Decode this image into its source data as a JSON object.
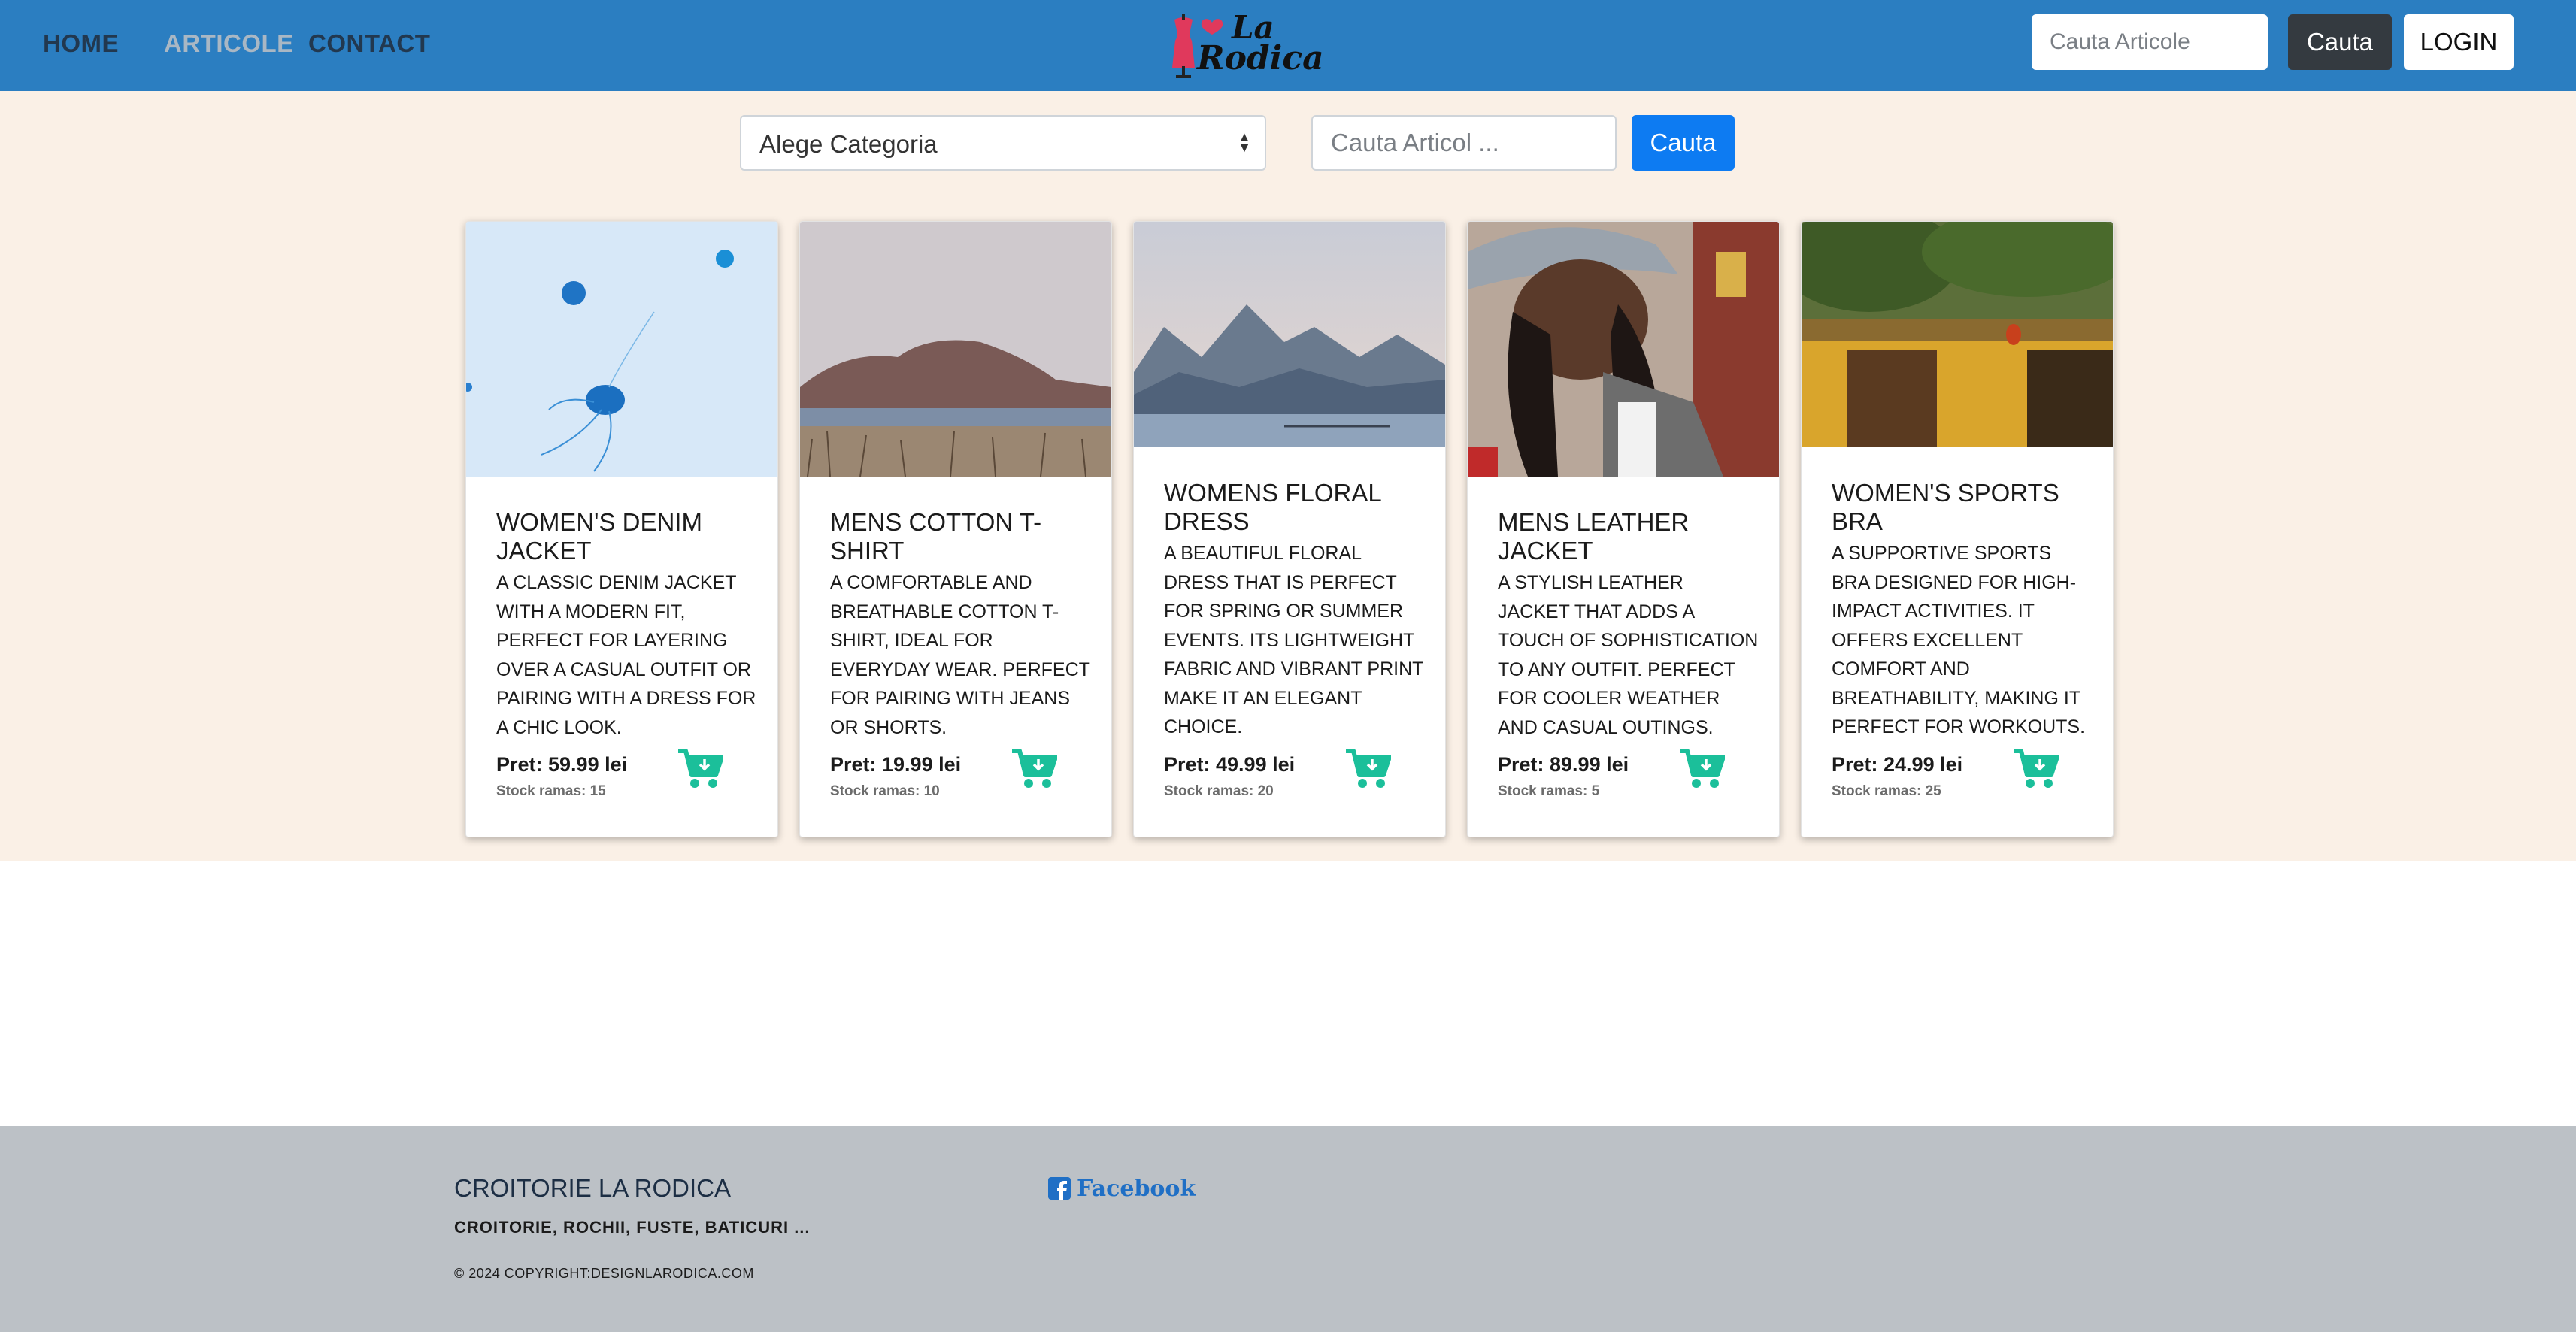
{
  "nav": {
    "home": "HOME",
    "articole": "ARTICOLE",
    "contact": "CONTACT",
    "logo_line1": "La",
    "logo_line2": "Rodica",
    "search_placeholder": "Cauta Articole",
    "search_button": "Cauta",
    "login_button": "LOGIN"
  },
  "filters": {
    "category_value": "Alege Categoria",
    "search_placeholder": "Cauta Articol ...",
    "search_button": "Cauta"
  },
  "products": [
    {
      "title": "Women's Denim Jacket",
      "description": "A classic denim jacket with a modern fit, perfect for layering over a casual outfit or pairing with a dress for a chic look.",
      "price": "Pret: 59.99 lei",
      "stock": "Stock ramas: 15",
      "image": "jellyfish-photo"
    },
    {
      "title": "Mens Cotton T-Shirt",
      "description": "A comfortable and breathable cotton T-shirt, ideal for everyday wear. Perfect for pairing with jeans or shorts.",
      "price": "Pret: 19.99 lei",
      "stock": "Stock ramas: 10",
      "image": "coast-landscape-photo"
    },
    {
      "title": "Womens Floral Dress",
      "description": "A beautiful floral dress that is perfect for spring or summer events. Its lightweight fabric and vibrant print make it an elegant choice.",
      "price": "Pret: 49.99 lei",
      "stock": "Stock ramas: 20",
      "image": "mountain-lake-photo"
    },
    {
      "title": "Mens Leather Jacket",
      "description": "A stylish leather jacket that adds a touch of sophistication to any outfit. Perfect for cooler weather and casual outings.",
      "price": "Pret: 89.99 lei",
      "stock": "Stock ramas: 5",
      "image": "woman-in-hat-photo"
    },
    {
      "title": "Women's Sports Bra",
      "description": "A supportive sports bra designed for high-impact activities. It offers excellent comfort and breathability, making it perfect for workouts.",
      "price": "Pret: 24.99 lei",
      "stock": "Stock ramas: 25",
      "image": "yellow-house-photo"
    }
  ],
  "footer": {
    "title": "CROITORIE LA RODICA",
    "subtitle": "CROITORIE, ROCHII, FUSTE, BATICURI ...",
    "copyright": "© 2024 COPYRIGHT:DESIGNLARODICA.COM",
    "facebook": "Facebook"
  },
  "colors": {
    "navbar": "#2b7ec1",
    "main_bg": "#faf0e6",
    "primary_button": "#0d7bf2",
    "cart_icon": "#1bbf9a",
    "footer_bg": "#bcc1c6"
  }
}
